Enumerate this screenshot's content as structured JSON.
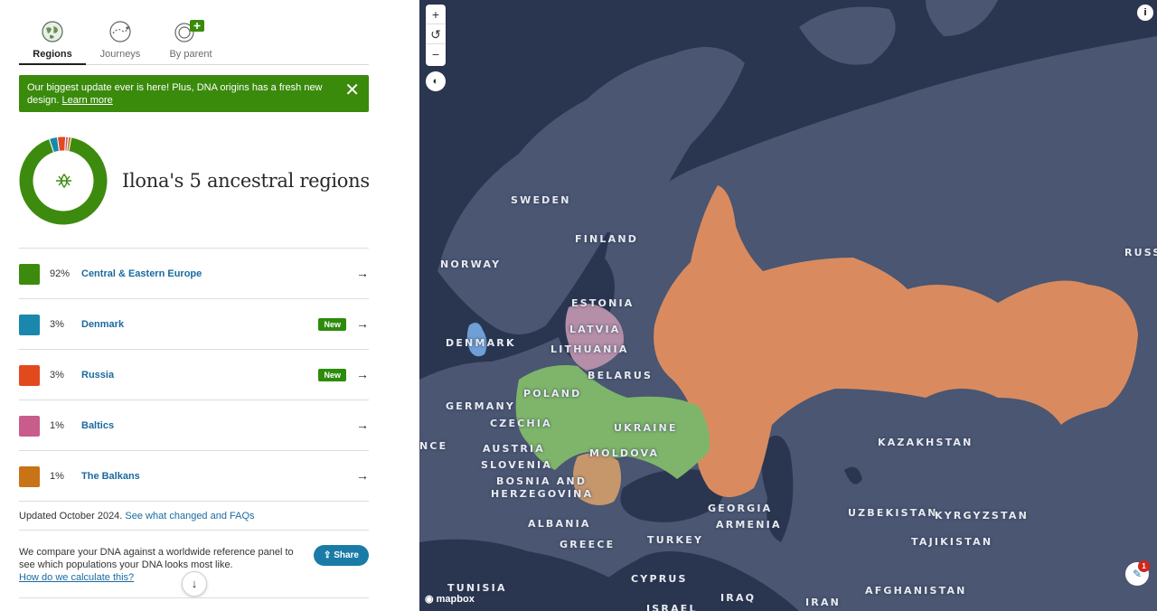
{
  "tabs": [
    {
      "label": "Regions",
      "icon": "globe-icon",
      "active": true
    },
    {
      "label": "Journeys",
      "icon": "journeys-icon",
      "active": false
    },
    {
      "label": "By parent",
      "icon": "parents-icon",
      "active": false
    }
  ],
  "banner": {
    "text": "Our biggest update ever is here! Plus, DNA origins has a fresh new design.",
    "link": "Learn more",
    "close_icon": "close-icon"
  },
  "summary": {
    "title": "Ilona's 5 ancestral regions",
    "center_icon": "dna-leaf-icon"
  },
  "regions": [
    {
      "percent": "92%",
      "name": "Central & Eastern Europe",
      "color": "#3d8b0e",
      "badge": "",
      "value": 92
    },
    {
      "percent": "3%",
      "name": "Denmark",
      "color": "#1a87ad",
      "badge": "New",
      "value": 3
    },
    {
      "percent": "3%",
      "name": "Russia",
      "color": "#e2491d",
      "badge": "New",
      "value": 3
    },
    {
      "percent": "1%",
      "name": "Baltics",
      "color": "#c85c8a",
      "badge": "",
      "value": 1
    },
    {
      "percent": "1%",
      "name": "The Balkans",
      "color": "#c77316",
      "badge": "",
      "value": 1
    }
  ],
  "updated": {
    "text": "Updated October 2024.",
    "link": "See what changed and FAQs"
  },
  "compare": {
    "text": "We compare your DNA against a worldwide reference panel to see which populations your DNA looks most like.",
    "link": "How do we calculate this?"
  },
  "share_label": "Share",
  "map": {
    "controls": {
      "zoom_in": "+",
      "reset": "↺",
      "zoom_out": "−"
    },
    "attribution": "mapbox",
    "help_badge": "1",
    "colors": {
      "land": "#4a5672",
      "sea": "#2a3650",
      "central_eastern": "#7fb56a",
      "russia": "#d98b5f",
      "baltics": "#b58ea8",
      "denmark": "#6f9fd6",
      "balkans": "#c7976c"
    },
    "labels": [
      "SWEDEN",
      "FINLAND",
      "NORWAY",
      "ESTONIA",
      "LATVIA",
      "LITHUANIA",
      "DENMARK",
      "BELARUS",
      "POLAND",
      "GERMANY",
      "CZECHIA",
      "UKRAINE",
      "NCE",
      "AUSTRIA",
      "MOLDOVA",
      "SLOVENIA",
      "BOSNIA AND",
      "HERZEGOVINA",
      "ALBANIA",
      "GREECE",
      "TURKEY",
      "GEORGIA",
      "ARMENIA",
      "KAZAKHSTAN",
      "UZBEKISTAN",
      "KYRGYZSTAN",
      "TAJIKISTAN",
      "TUNISIA",
      "CYPRUS",
      "IRAQ",
      "IRAN",
      "AFGHANISTAN",
      "ISRAEL",
      "RUSS"
    ]
  }
}
